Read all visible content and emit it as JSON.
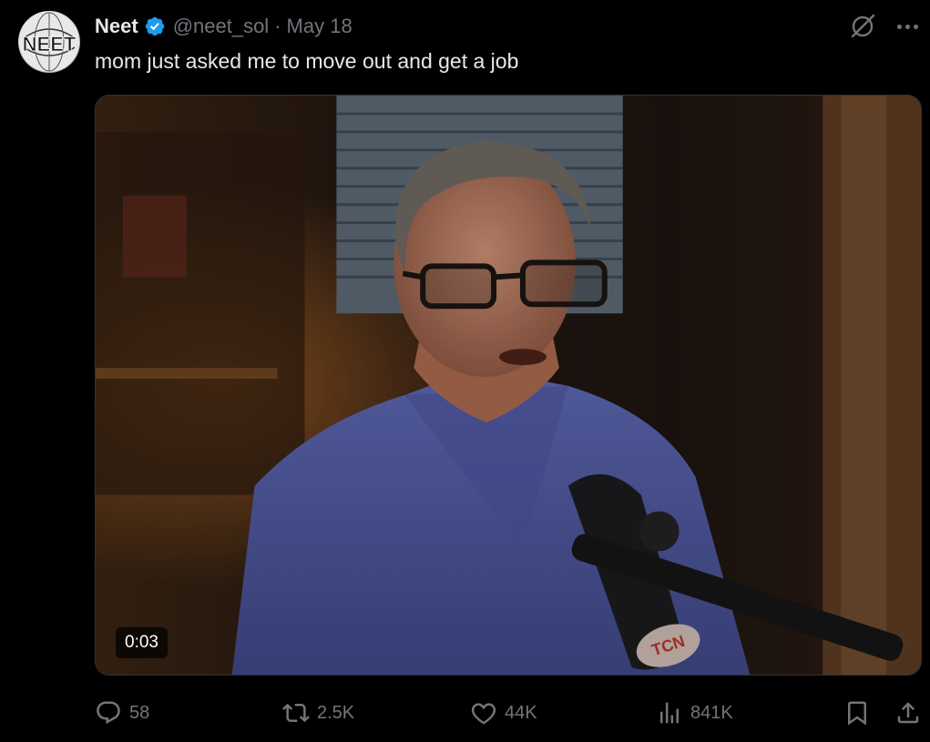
{
  "author": {
    "avatar_text": "NEET",
    "name": "Neet",
    "handle": "@neet_sol",
    "separator": "·",
    "date": "May 18",
    "verified_color": "#1d9bf0"
  },
  "tweet": {
    "text": "mom just asked me to move out and get a job"
  },
  "media": {
    "type": "video",
    "timestamp": "0:03",
    "mic_logo_text": "TCN"
  },
  "actions": {
    "replies": "58",
    "reposts": "2.5K",
    "likes": "44K",
    "views": "841K"
  },
  "icons": {
    "grok": "grok-icon",
    "more": "more-icon",
    "reply": "reply-icon",
    "repost": "repost-icon",
    "like": "like-icon",
    "views": "views-icon",
    "bookmark": "bookmark-icon",
    "share": "share-icon"
  },
  "colors": {
    "background": "#000000",
    "text": "#e7e9ea",
    "muted": "#71767b",
    "accent": "#1d9bf0"
  }
}
